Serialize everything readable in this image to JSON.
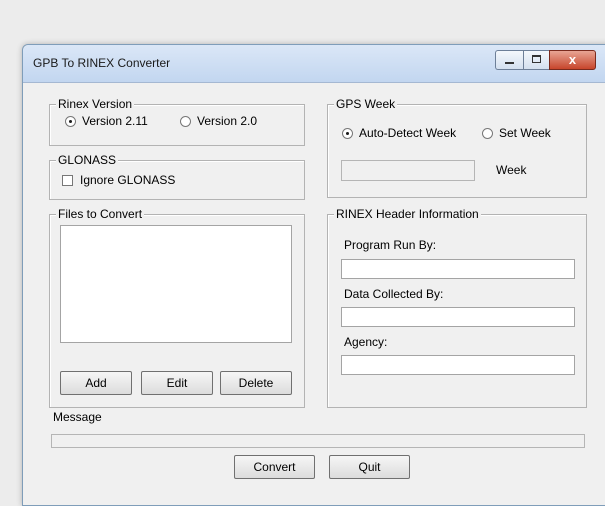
{
  "window": {
    "title": "GPB To RINEX Converter",
    "close_glyph": "x"
  },
  "rinex_version": {
    "legend": "Rinex Version",
    "options": [
      "Version 2.11",
      "Version 2.0"
    ],
    "selected": "Version 2.11"
  },
  "glonass": {
    "legend": "GLONASS",
    "ignore_label": "Ignore GLONASS",
    "ignore_checked": false
  },
  "files": {
    "legend": "Files to Convert",
    "items": [],
    "add_label": "Add",
    "edit_label": "Edit",
    "delete_label": "Delete"
  },
  "gps_week": {
    "legend": "GPS Week",
    "options": [
      "Auto-Detect Week",
      "Set Week"
    ],
    "selected": "Auto-Detect Week",
    "week_value": "",
    "week_label": "Week"
  },
  "header_info": {
    "legend": "RINEX Header Information",
    "program_run_by_label": "Program Run By:",
    "program_run_by_value": "",
    "data_collected_by_label": "Data Collected By:",
    "data_collected_by_value": "",
    "agency_label": "Agency:",
    "agency_value": ""
  },
  "message": {
    "label": "Message",
    "value": ""
  },
  "footer": {
    "convert_label": "Convert",
    "quit_label": "Quit"
  }
}
